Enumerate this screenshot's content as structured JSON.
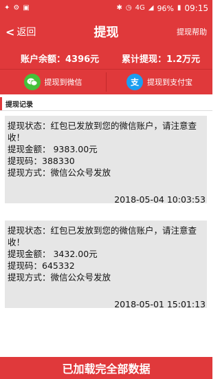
{
  "statusbar": {
    "battery": "96%",
    "time": "09:15",
    "network": "4G"
  },
  "header": {
    "back_label": "返回",
    "title": "提现",
    "help_label": "提现帮助"
  },
  "balance": {
    "account_label": "账户余额：4396元",
    "total_label": "累计提现：1.2万元"
  },
  "actions": {
    "wechat_label": "提现到微信",
    "alipay_label": "提现到支付宝"
  },
  "section": {
    "title": "提现记录"
  },
  "records": [
    {
      "status": "提现状态：红包已发放到您的微信账户，请注意查收！",
      "amount": "提现金额：  9383.00元",
      "code": "提现码：388330",
      "method": "提现方式：微信公众号发放",
      "date": "2018-05-04 10:03:53"
    },
    {
      "status": "提现状态：红包已发放到您的微信账户，请注意查收！",
      "amount": "提现金额：  3432.00元",
      "code": "提现码：645332",
      "method": "提现方式：微信公众号发放",
      "date": "2018-05-01 15:01:13"
    }
  ],
  "footer": {
    "label": "已加载完全部数据"
  },
  "colors": {
    "brand": "#e0393b",
    "wechat": "#46c03a",
    "alipay": "#1b9ef0",
    "card": "#e6e6e6"
  }
}
